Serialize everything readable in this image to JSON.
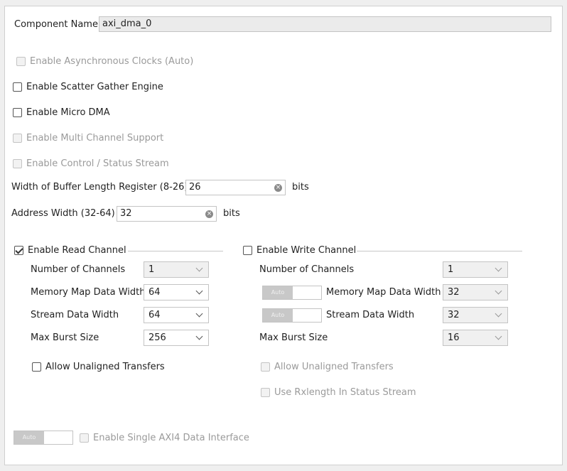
{
  "component": {
    "label": "Component Name",
    "value": "axi_dma_0"
  },
  "options": {
    "async_clocks": "Enable Asynchronous Clocks (Auto)",
    "scatter_gather": "Enable Scatter Gather Engine",
    "micro_dma": "Enable Micro DMA",
    "multi_channel": "Enable Multi Channel Support",
    "control_status": "Enable Control / Status Stream"
  },
  "buffer_length": {
    "label": "Width of Buffer Length Register (8-26)",
    "value": "26",
    "unit": "bits"
  },
  "address_width": {
    "label": "Address Width (32-64)",
    "value": "32",
    "unit": "bits"
  },
  "read_channel": {
    "title": "Enable Read Channel",
    "checked": true,
    "num_channels_label": "Number of Channels",
    "num_channels": "1",
    "mm_width_label": "Memory Map Data Width",
    "mm_width": "64",
    "stream_width_label": "Stream Data Width",
    "stream_width": "64",
    "burst_label": "Max Burst Size",
    "burst": "256",
    "unaligned": "Allow Unaligned Transfers"
  },
  "write_channel": {
    "title": "Enable Write Channel",
    "checked": false,
    "num_channels_label": "Number of Channels",
    "num_channels": "1",
    "mm_width_label": "Memory Map Data Width",
    "mm_width": "32",
    "stream_width_label": "Stream Data Width",
    "stream_width": "32",
    "burst_label": "Max Burst Size",
    "burst": "16",
    "unaligned": "Allow Unaligned Transfers",
    "rxlength": "Use Rxlength In Status Stream"
  },
  "toggle_auto": "Auto",
  "single_axi": "Enable Single AXI4 Data Interface",
  "icons": {
    "clear": "clear-icon",
    "dropdown": "chevron-down-icon"
  }
}
